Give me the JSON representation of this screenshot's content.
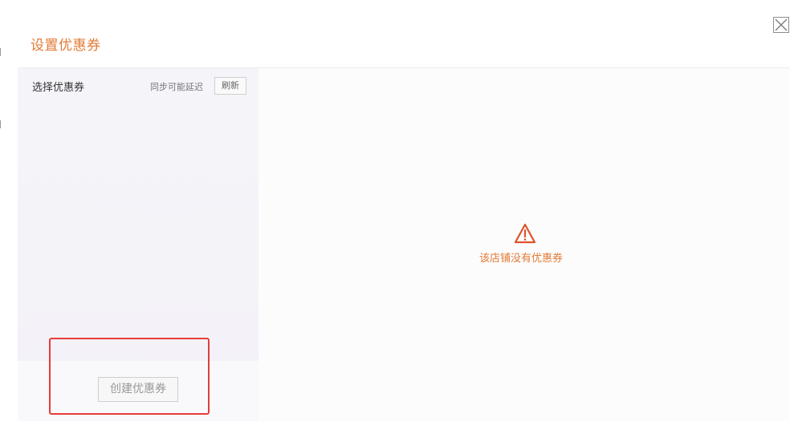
{
  "dialog": {
    "title": "设置优惠券",
    "close_icon": "close-icon"
  },
  "left_panel": {
    "label": "选择优惠券",
    "sync_text": "同步可能延迟",
    "refresh_label": "刷新",
    "create_button_label": "创建优惠券"
  },
  "right_panel": {
    "warning_icon": "warning-triangle-icon",
    "empty_message": "该店铺没有优惠券"
  },
  "colors": {
    "accent": "#e37a36",
    "highlight": "#e63b3b"
  }
}
